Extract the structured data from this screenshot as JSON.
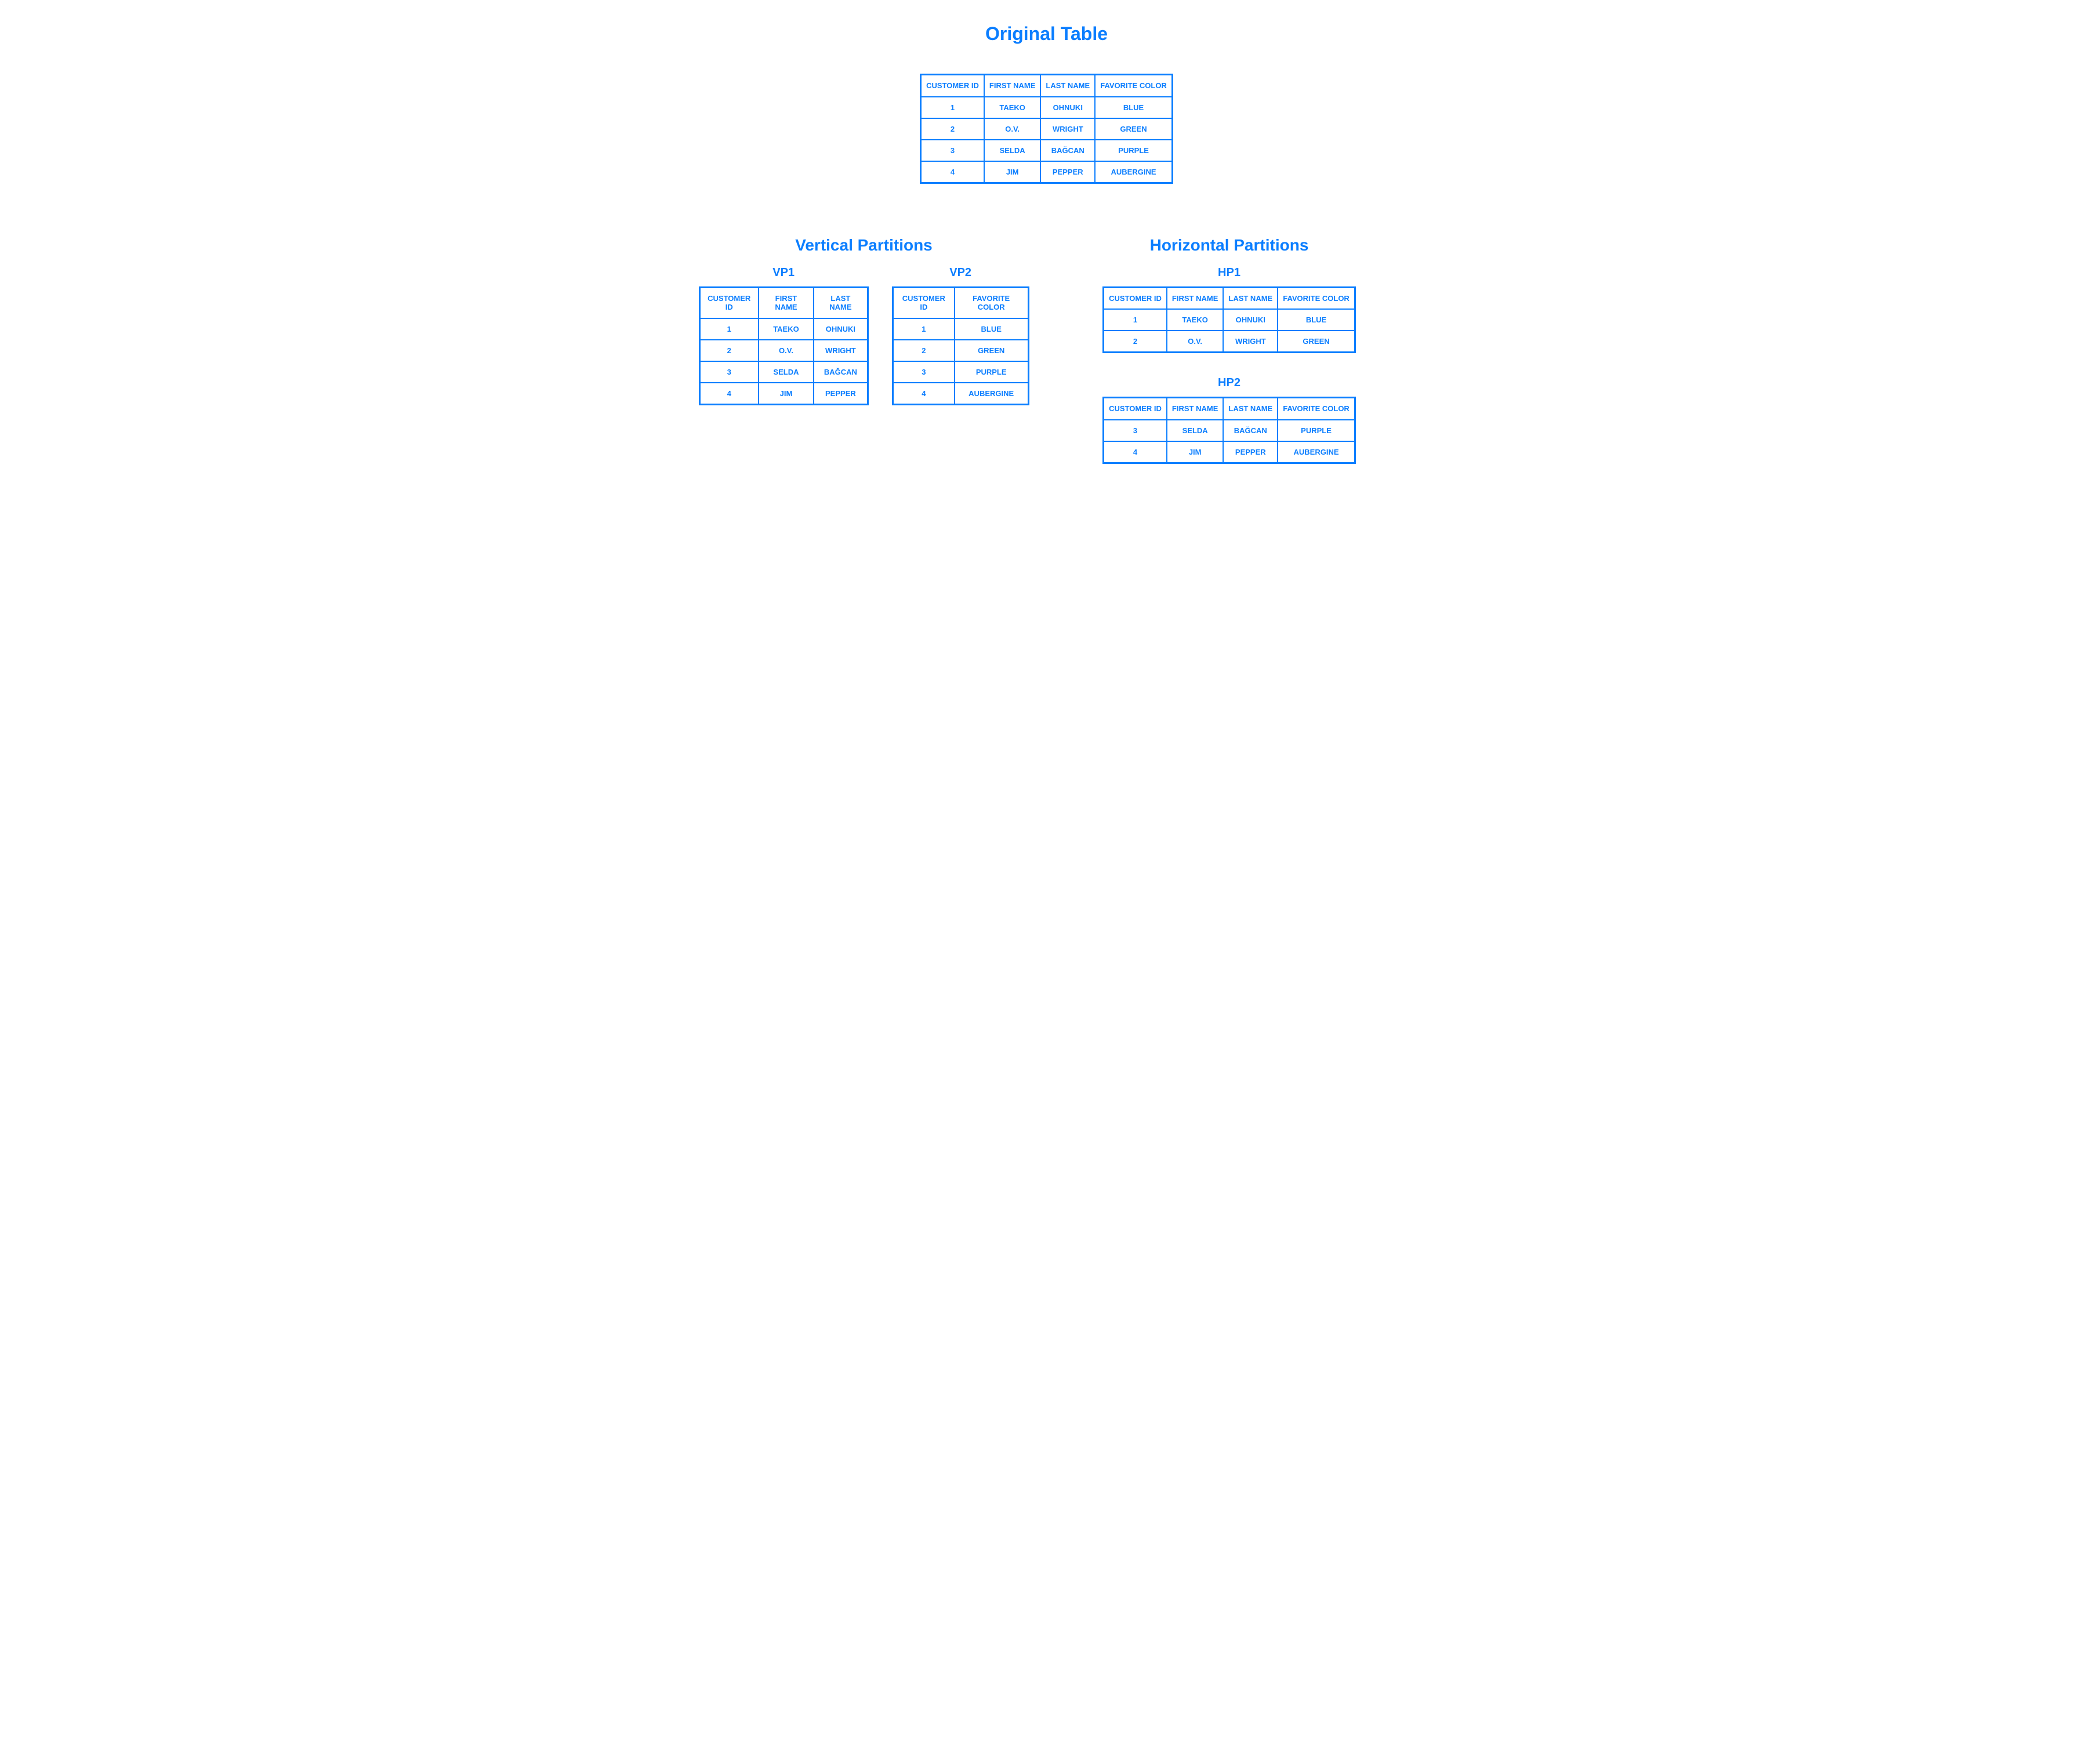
{
  "titles": {
    "original": "Original Table",
    "vertical": "Vertical Partitions",
    "horizontal": "Horizontal Partitions",
    "vp1": "VP1",
    "vp2": "VP2",
    "hp1": "HP1",
    "hp2": "HP2"
  },
  "headers": {
    "customer_id": "CUSTOMER ID",
    "first_name": "FIRST NAME",
    "last_name": "LAST NAME",
    "favorite_color": "FAVORITE COLOR"
  },
  "original_rows": [
    {
      "id": "1",
      "first": "TAEKO",
      "last": "OHNUKI",
      "color": "BLUE"
    },
    {
      "id": "2",
      "first": "O.V.",
      "last": "WRIGHT",
      "color": "GREEN"
    },
    {
      "id": "3",
      "first": "SELDA",
      "last": "BAĞCAN",
      "color": "PURPLE"
    },
    {
      "id": "4",
      "first": "JIM",
      "last": "PEPPER",
      "color": "AUBERGINE"
    }
  ],
  "vp1_rows": [
    {
      "id": "1",
      "first": "TAEKO",
      "last": "OHNUKI"
    },
    {
      "id": "2",
      "first": "O.V.",
      "last": "WRIGHT"
    },
    {
      "id": "3",
      "first": "SELDA",
      "last": "BAĞCAN"
    },
    {
      "id": "4",
      "first": "JIM",
      "last": "PEPPER"
    }
  ],
  "vp2_rows": [
    {
      "id": "1",
      "color": "BLUE"
    },
    {
      "id": "2",
      "color": "GREEN"
    },
    {
      "id": "3",
      "color": "PURPLE"
    },
    {
      "id": "4",
      "color": "AUBERGINE"
    }
  ],
  "hp1_rows": [
    {
      "id": "1",
      "first": "TAEKO",
      "last": "OHNUKI",
      "color": "BLUE"
    },
    {
      "id": "2",
      "first": "O.V.",
      "last": "WRIGHT",
      "color": "GREEN"
    }
  ],
  "hp2_rows": [
    {
      "id": "3",
      "first": "SELDA",
      "last": "BAĞCAN",
      "color": "PURPLE"
    },
    {
      "id": "4",
      "first": "JIM",
      "last": "PEPPER",
      "color": "AUBERGINE"
    }
  ]
}
